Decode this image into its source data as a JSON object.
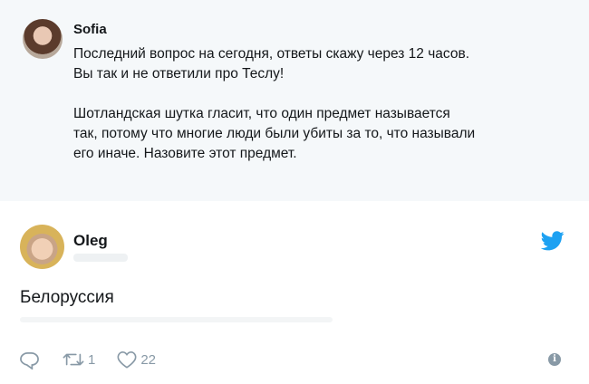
{
  "quoted_tweet": {
    "author_name": "Sofia",
    "paragraphs": [
      "Последний вопрос на сегодня, ответы скажу через 12 часов.\nВы так и не ответили про Теслу!",
      "Шотландская шутка гласит, что один предмет называется\nтак, потому что многие люди были убиты за то, что называли\nего иначе. Назовите этот предмет."
    ]
  },
  "tweet": {
    "author_name": "Oleg",
    "text": "Белоруссия"
  },
  "actions": {
    "retweet_count": "1",
    "like_count": "22"
  },
  "icons": {
    "reply": "reply-icon",
    "retweet": "retweet-icon",
    "like": "heart-icon",
    "info": "info-icon",
    "brand": "twitter-bird-icon"
  },
  "colors": {
    "quote_background": "#f5f8fa",
    "brand_blue": "#1da1f2",
    "icon_gray": "#8899a6"
  }
}
